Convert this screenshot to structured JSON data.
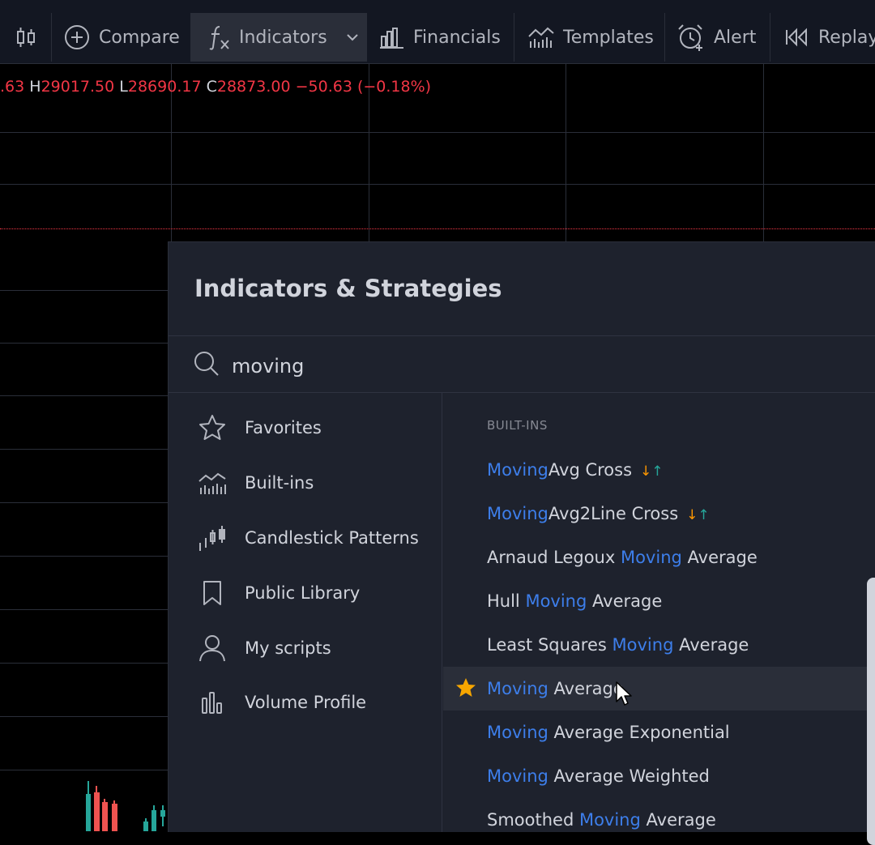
{
  "toolbar": {
    "compare": "Compare",
    "indicators": "Indicators",
    "financials": "Financials",
    "templates": "Templates",
    "alert": "Alert",
    "replay": "Replay"
  },
  "ohlc": {
    "open_value": ".63",
    "high_key": "H",
    "high_value": "29017.50",
    "low_key": "L",
    "low_value": "28690.17",
    "close_key": "C",
    "close_value": "28873.00",
    "change": "−50.63",
    "change_pct": "(−0.18%)"
  },
  "dialog": {
    "title": "Indicators & Strategies",
    "search": {
      "value": "moving",
      "placeholder": "Search"
    },
    "categories": [
      {
        "label": "Favorites",
        "icon": "star-outline-icon"
      },
      {
        "label": "Built-ins",
        "icon": "chart-bars-icon"
      },
      {
        "label": "Candlestick Patterns",
        "icon": "candlestick-icon"
      },
      {
        "label": "Public Library",
        "icon": "bookmark-icon"
      },
      {
        "label": "My scripts",
        "icon": "user-icon"
      },
      {
        "label": "Volume Profile",
        "icon": "volume-profile-icon"
      }
    ],
    "section_label": "BUILT-INS",
    "results": [
      {
        "before": "",
        "match": "Moving",
        "after": "Avg Cross",
        "arrows": true,
        "favorite": false
      },
      {
        "before": "",
        "match": "Moving",
        "after": "Avg2Line Cross",
        "arrows": true,
        "favorite": false
      },
      {
        "before": "Arnaud Legoux ",
        "match": "Moving",
        "after": " Average",
        "arrows": false,
        "favorite": false
      },
      {
        "before": "Hull ",
        "match": "Moving",
        "after": " Average",
        "arrows": false,
        "favorite": false
      },
      {
        "before": "Least Squares ",
        "match": "Moving",
        "after": " Average",
        "arrows": false,
        "favorite": false
      },
      {
        "before": "",
        "match": "Moving",
        "after": " Average",
        "arrows": false,
        "favorite": true
      },
      {
        "before": "",
        "match": "Moving",
        "after": " Average Exponential",
        "arrows": false,
        "favorite": false
      },
      {
        "before": "",
        "match": "Moving",
        "after": " Average Weighted",
        "arrows": false,
        "favorite": false
      },
      {
        "before": "Smoothed ",
        "match": "Moving",
        "after": " Average",
        "arrows": false,
        "favorite": false
      }
    ],
    "strategy_arrows": {
      "down": "↓",
      "up": "↑"
    }
  },
  "colors": {
    "match": "#3d7eea",
    "down_price": "#f23645",
    "favorite_star": "#f7a600",
    "panel_bg": "#1e222d"
  }
}
